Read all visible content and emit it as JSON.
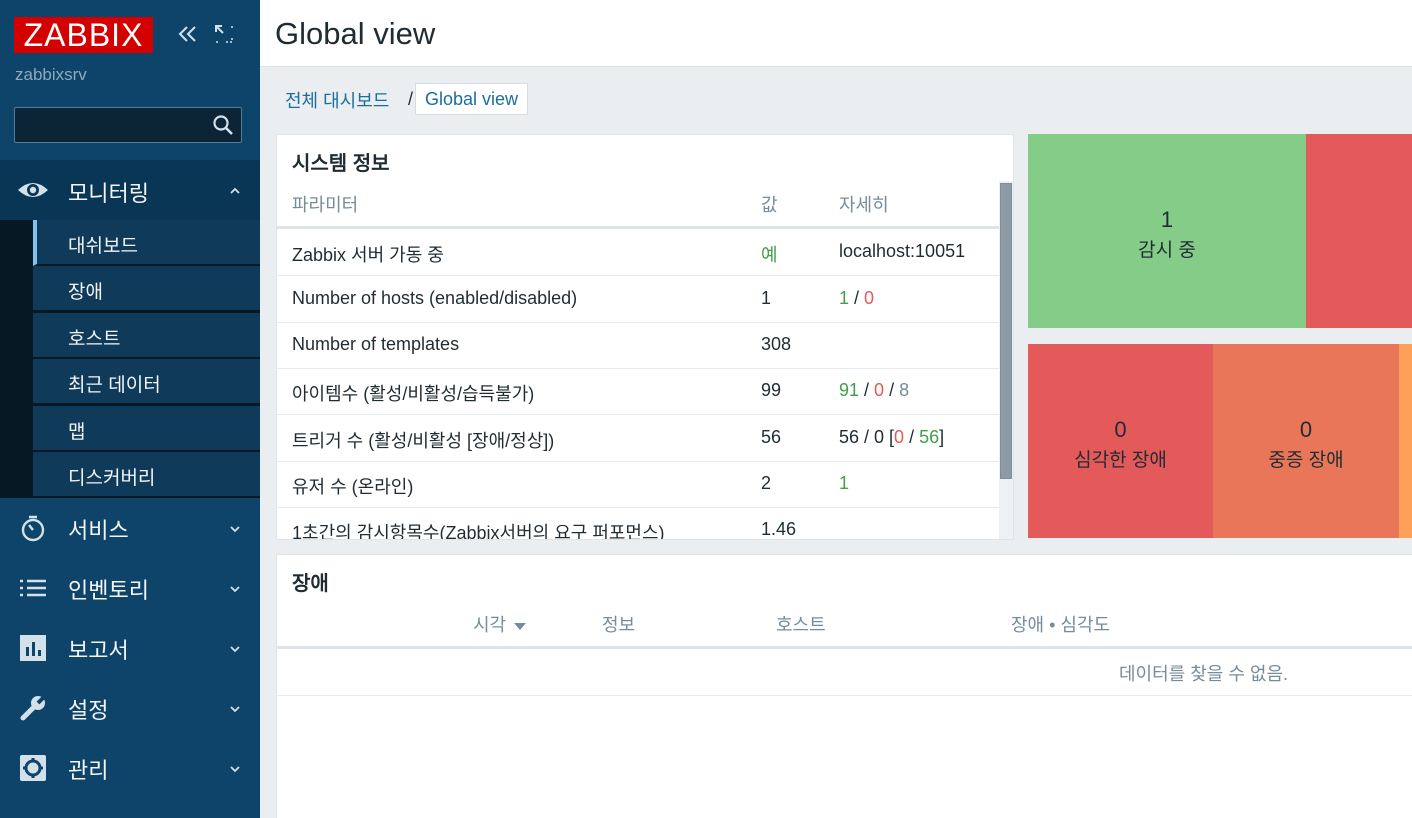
{
  "brand": {
    "logo_text": "ZABBIX",
    "server_name": "zabbixsrv",
    "accent": "#d40000"
  },
  "search": {
    "placeholder": "",
    "value": ""
  },
  "sidebar": {
    "menus": [
      {
        "label": "모니터링",
        "icon": "eye-icon",
        "expanded": true,
        "items": [
          {
            "label": "대쉬보드",
            "active": true
          },
          {
            "label": "장애"
          },
          {
            "label": "호스트"
          },
          {
            "label": "최근 데이터"
          },
          {
            "label": "맵"
          },
          {
            "label": "디스커버리"
          }
        ]
      },
      {
        "label": "서비스",
        "icon": "stopwatch-icon"
      },
      {
        "label": "인벤토리",
        "icon": "list-icon"
      },
      {
        "label": "보고서",
        "icon": "bar-chart-icon"
      },
      {
        "label": "설정",
        "icon": "wrench-icon"
      },
      {
        "label": "관리",
        "icon": "gear-icon"
      }
    ]
  },
  "header": {
    "title": "Global view"
  },
  "breadcrumb": {
    "parent": "전체 대시보드",
    "separator": "/",
    "current": "Global view"
  },
  "system_info": {
    "title": "시스템 정보",
    "columns": [
      "파라미터",
      "값",
      "자세히"
    ],
    "rows": [
      {
        "param": "Zabbix 서버 가동 중",
        "value": "예",
        "details": "localhost:10051"
      },
      {
        "param": "Number of hosts (enabled/disabled)",
        "value": "1",
        "d1": "1",
        "sep1": " / ",
        "d2": "0"
      },
      {
        "param": "Number of templates",
        "value": "308"
      },
      {
        "param": "아이템수 (활성/비활성/습득불가)",
        "value": "99",
        "d1": "91",
        "sep1": " / ",
        "d2": "0",
        "sep2": " / ",
        "d3": "8"
      },
      {
        "param": "트리거 수 (활성/비활성 [장애/정상])",
        "value": "56",
        "d0": "56 / 0 [",
        "d1": "0",
        "sep1": " / ",
        "d2": "56",
        "d3": "]"
      },
      {
        "param": "유저 수 (온라인)",
        "value": "2",
        "details": "1"
      },
      {
        "param": "1초간의 감시항목수(Zabbix서버의 요구 퍼포먼스)",
        "value": "1.46"
      }
    ]
  },
  "host_availability": {
    "tiles": [
      {
        "count": "1",
        "label": "감시 중",
        "color": "#86cc89"
      },
      {
        "count": "",
        "label": "",
        "color": "#e45959"
      }
    ],
    "severity_tiles": [
      {
        "count": "0",
        "label": "심각한 장애",
        "color": "#e45959"
      },
      {
        "count": "0",
        "label": "중증 장애",
        "color": "#e97659"
      },
      {
        "count": "",
        "label": "",
        "color": "#ffa059"
      }
    ]
  },
  "problems": {
    "title": "장애",
    "columns": {
      "time": "시각",
      "info": "정보",
      "host": "호스트",
      "problem": "장애 • 심각도"
    },
    "empty_message": "데이터를 찾을 수 없음."
  }
}
